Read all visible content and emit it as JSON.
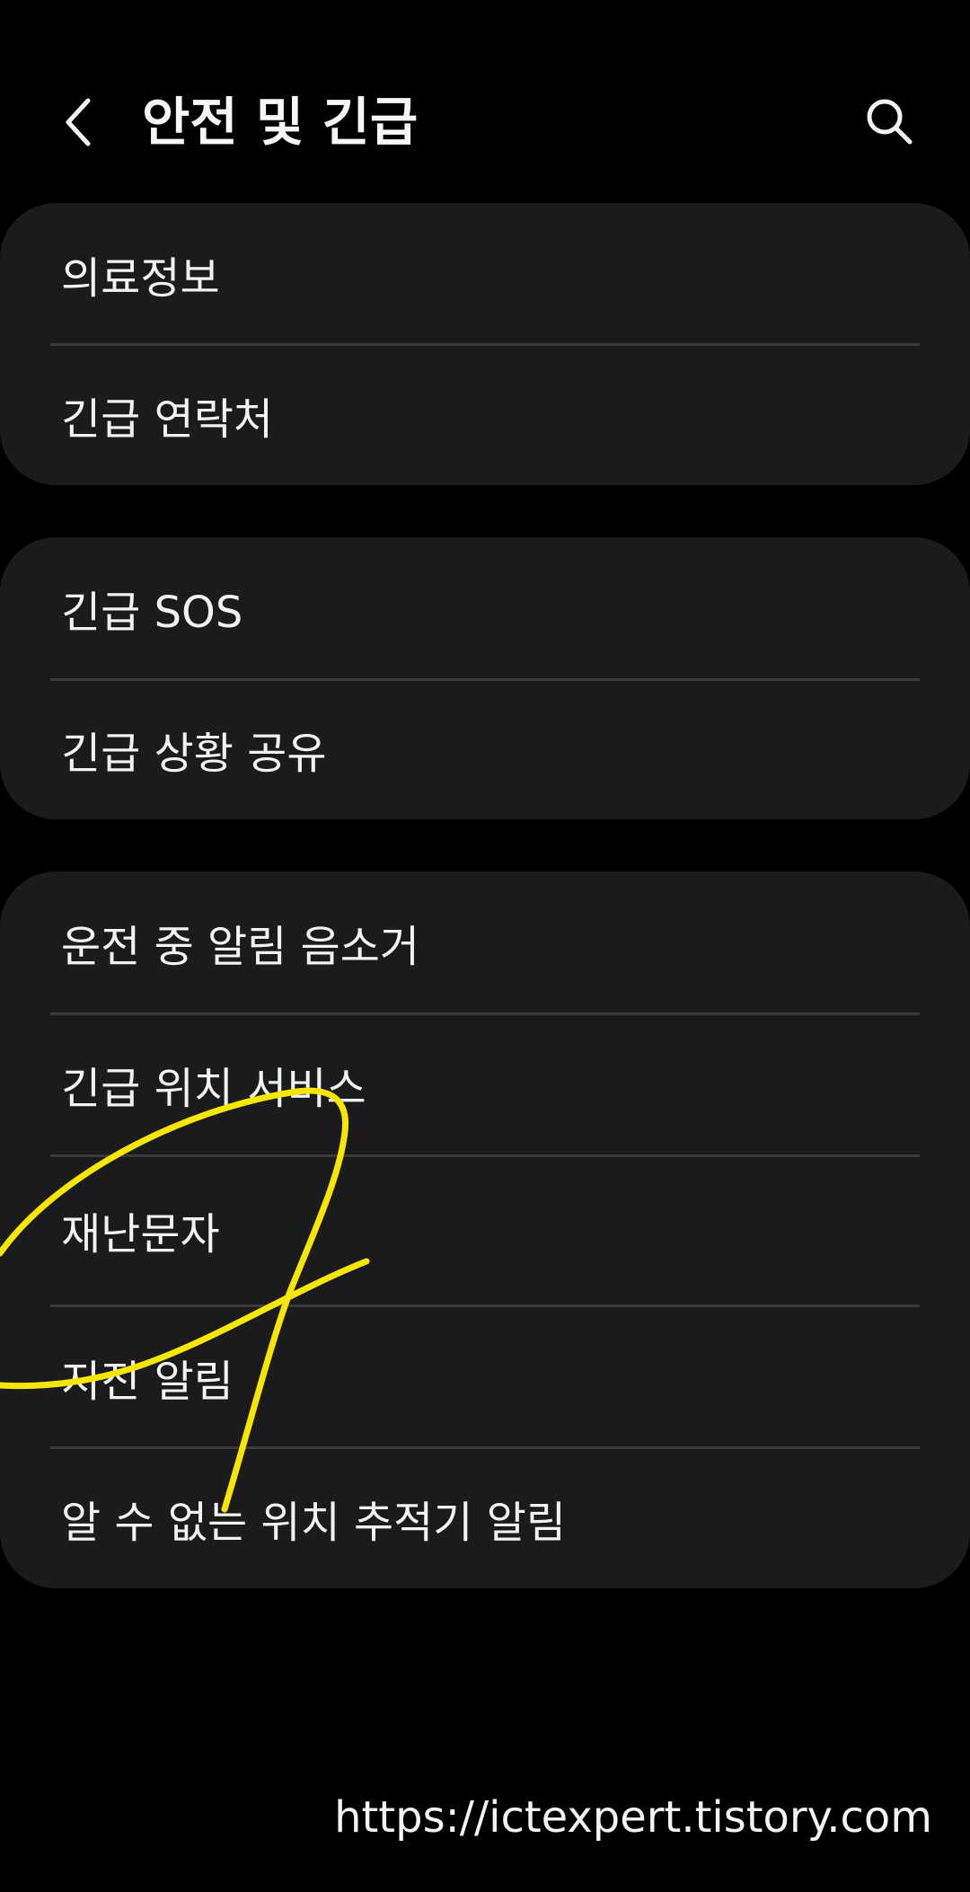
{
  "header": {
    "title": "안전 및 긴급",
    "back_icon": "chevron-left-icon",
    "search_icon": "search-icon"
  },
  "groups": [
    {
      "items": [
        {
          "label": "의료정보"
        },
        {
          "label": "긴급 연락처"
        }
      ]
    },
    {
      "items": [
        {
          "label": "긴급 SOS"
        },
        {
          "label": "긴급 상황 공유"
        }
      ]
    },
    {
      "items": [
        {
          "label": "운전 중 알림 음소거"
        },
        {
          "label": "긴급 위치 서비스"
        },
        {
          "label": "재난문자"
        },
        {
          "label": "지진 알림"
        },
        {
          "label": "알 수 없는 위치 추적기 알림"
        }
      ]
    }
  ],
  "watermark": "https://ictexpert.tistory.com",
  "colors": {
    "background": "#000000",
    "card": "#1b1b1d",
    "divider": "#3a3a3c",
    "text": "#f2f2f2",
    "annotation": "#f7e600"
  }
}
